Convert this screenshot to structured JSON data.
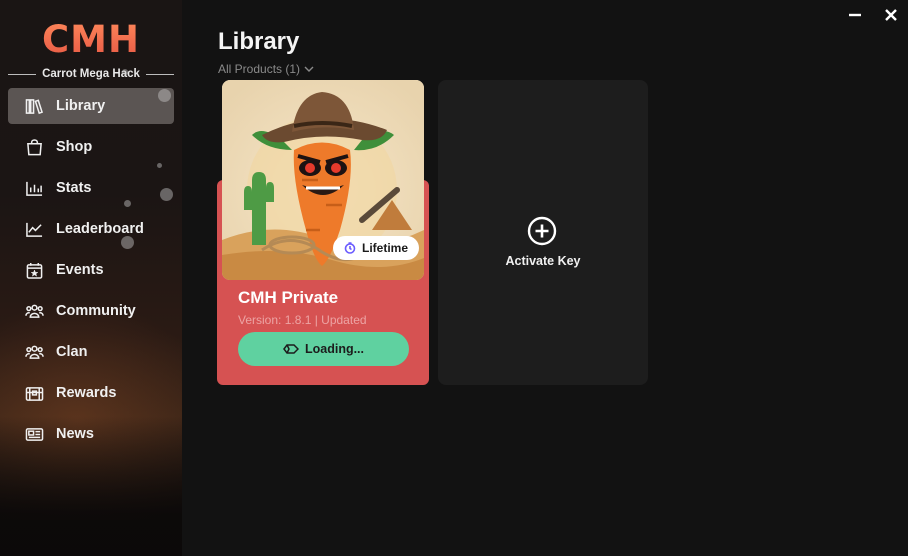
{
  "app": {
    "brand": "CMH",
    "tagline": "Carrot Mega Hack"
  },
  "sidebar": {
    "items": [
      {
        "label": "Library",
        "icon": "library-icon",
        "active": true
      },
      {
        "label": "Shop",
        "icon": "shopping-bag-icon"
      },
      {
        "label": "Stats",
        "icon": "bar-chart-icon"
      },
      {
        "label": "Leaderboard",
        "icon": "trend-chart-icon"
      },
      {
        "label": "Events",
        "icon": "calendar-star-icon"
      },
      {
        "label": "Community",
        "icon": "people-group-icon"
      },
      {
        "label": "Clan",
        "icon": "team-icon"
      },
      {
        "label": "Rewards",
        "icon": "treasure-chest-icon"
      },
      {
        "label": "News",
        "icon": "newspaper-icon"
      }
    ]
  },
  "header": {
    "title": "Library",
    "filter_label": "All Products (1)"
  },
  "products": [
    {
      "name": "CMH Private",
      "version": "Version: 1.8.1 | Updated",
      "badge": "Lifetime",
      "button_label": "Loading..."
    }
  ],
  "activate": {
    "label": "Activate Key"
  },
  "colors": {
    "accent": "#d65252",
    "button": "#5fd1a0",
    "brand": "#f06a4d"
  }
}
